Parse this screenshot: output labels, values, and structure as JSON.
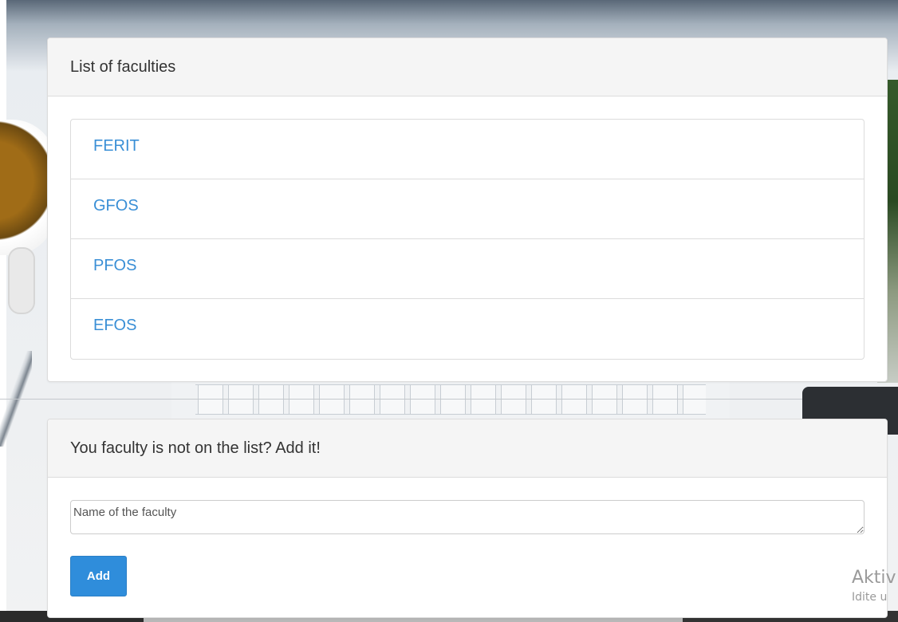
{
  "faculties_panel": {
    "title": "List of faculties",
    "items": [
      {
        "label": "FERIT"
      },
      {
        "label": "GFOS"
      },
      {
        "label": "PFOS"
      },
      {
        "label": "EFOS"
      }
    ]
  },
  "add_panel": {
    "title": "You faculty is not on the list? Add it!",
    "input_placeholder": "Name of the faculty",
    "input_value": "",
    "add_label": "Add"
  },
  "watermark": {
    "line1": "Aktiv",
    "line2": "Idite u"
  },
  "colors": {
    "link": "#3a8fd6",
    "button": "#2f8ddb",
    "panel_heading_bg": "#f5f5f5"
  }
}
